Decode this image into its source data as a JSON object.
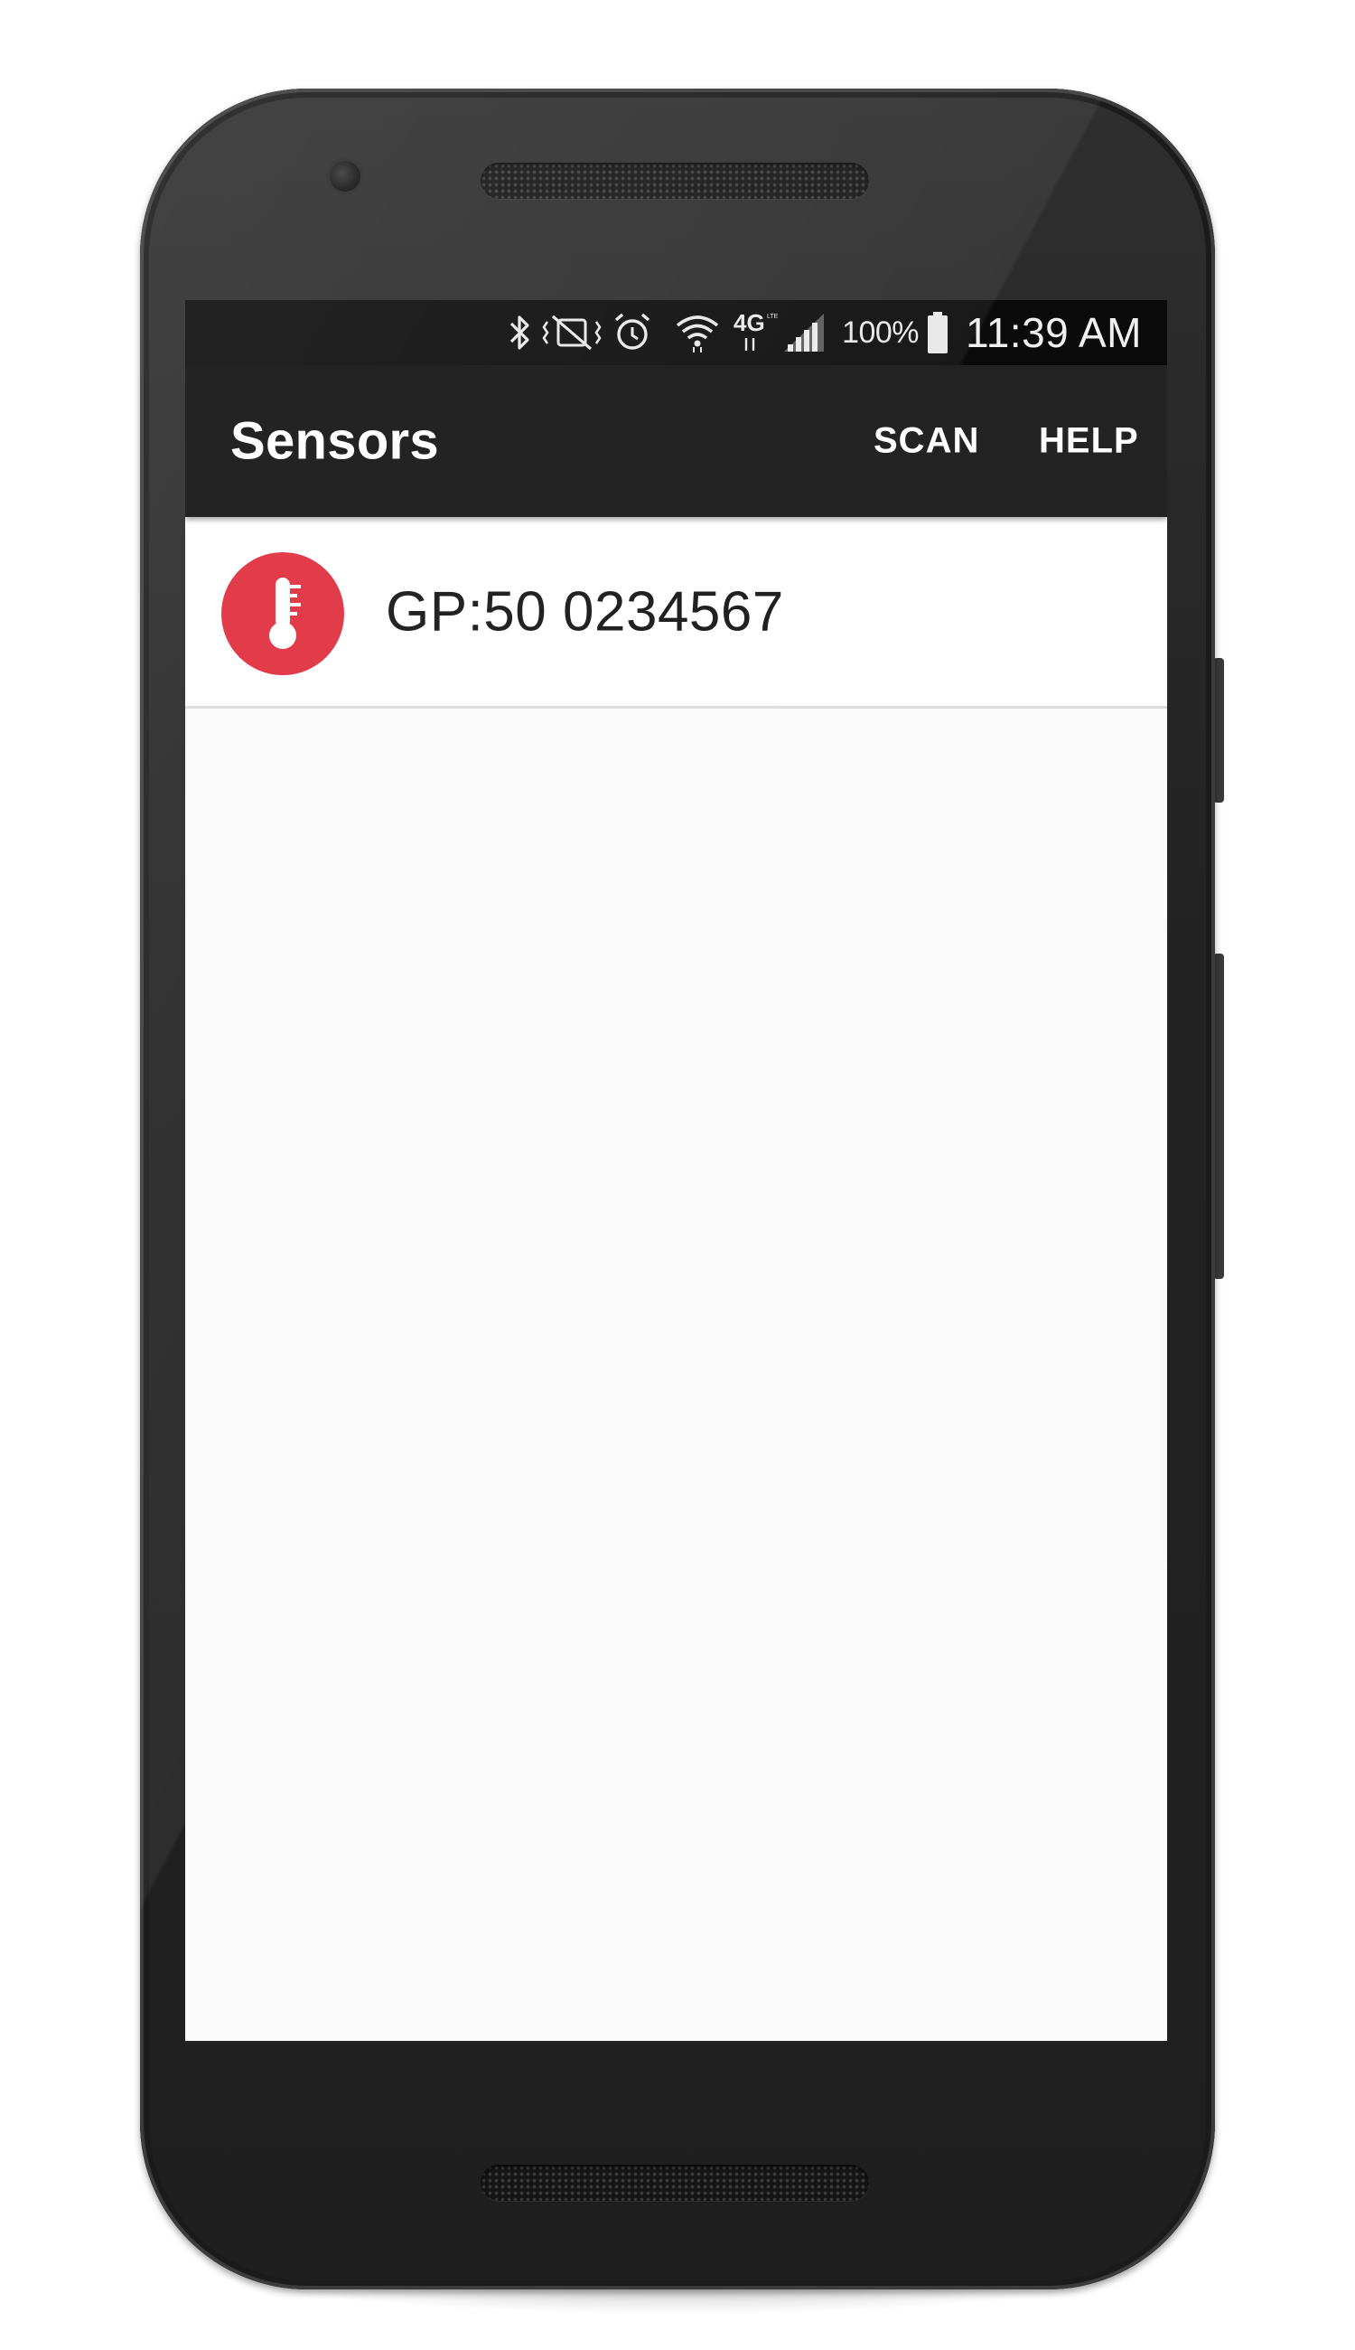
{
  "status_bar": {
    "icons": [
      "bluetooth-icon",
      "vibrate-off-icon",
      "alarm-icon",
      "wifi-icon",
      "4g-lte-icon",
      "signal-icon",
      "battery-icon"
    ],
    "network_label": "4G",
    "battery_percent": "100%",
    "time": "11:39 AM"
  },
  "app_bar": {
    "title": "Sensors",
    "actions": [
      {
        "label": "SCAN"
      },
      {
        "label": "HELP"
      }
    ]
  },
  "sensors": [
    {
      "icon": "thermometer-icon",
      "label": "GP:50 0234567",
      "color": "#e02a3a"
    }
  ],
  "colors": {
    "status_bar": "#0b0b0b",
    "app_bar": "#232323",
    "list_background": "#fafafa",
    "accent": "#e02a3a"
  }
}
